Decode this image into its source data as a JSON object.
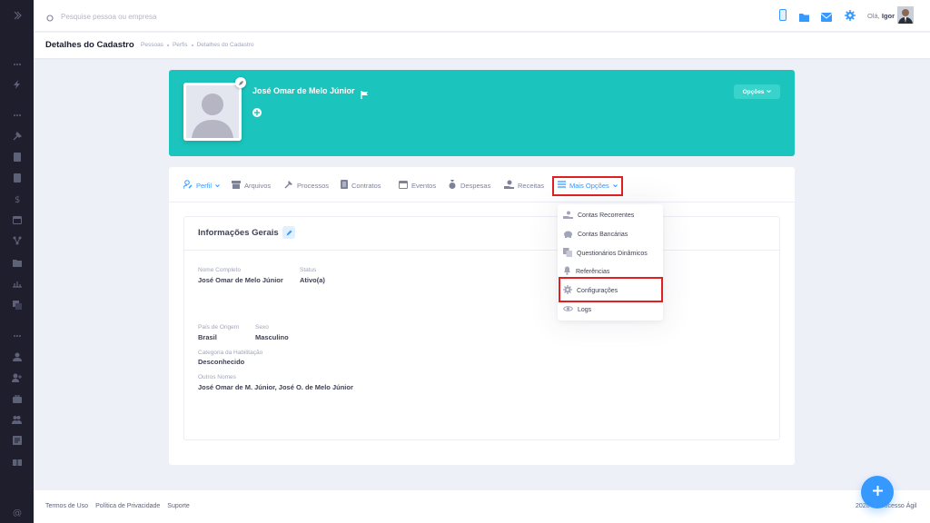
{
  "search": {
    "placeholder": "Pesquise pessoa ou empresa"
  },
  "topbar": {
    "greeting": "Olá,",
    "user": "Igor"
  },
  "subheader": {
    "title": "Detalhes do Cadastro",
    "breadcrumb": [
      "Pessoas",
      "Perfis",
      "Detalhes do Cadastro"
    ]
  },
  "profile": {
    "name": "José Omar de Melo Júnior",
    "options_label": "Opções"
  },
  "tabs": [
    {
      "label": "Perfil",
      "icon": "user-edit-icon"
    },
    {
      "label": "Arquivos",
      "icon": "archive-icon"
    },
    {
      "label": "Processos",
      "icon": "hammer-icon"
    },
    {
      "label": "Contratos",
      "icon": "document-icon"
    },
    {
      "label": "Eventos",
      "icon": "calendar-icon"
    },
    {
      "label": "Despesas",
      "icon": "money-bag-icon"
    },
    {
      "label": "Receitas",
      "icon": "hand-coin-icon"
    },
    {
      "label": "Mais Opções",
      "icon": "menu-icon"
    }
  ],
  "more_menu": [
    {
      "label": "Contas Recorrentes",
      "icon": "hand-coin-icon"
    },
    {
      "label": "Contas Bancárias",
      "icon": "piggy-bank-icon"
    },
    {
      "label": "Questionários Dinâmicos",
      "icon": "copy-icon"
    },
    {
      "label": "Referências",
      "icon": "bell-icon"
    },
    {
      "label": "Configurações",
      "icon": "gear-icon"
    },
    {
      "label": "Logs",
      "icon": "eye-icon"
    }
  ],
  "info": {
    "title": "Informações Gerais",
    "fields": {
      "nome_label": "Nome Completo",
      "nome_value": "José Omar de Melo Júnior",
      "status_label": "Status",
      "status_value": "Ativo(a)",
      "pais_label": "País de Origem",
      "pais_value": "Brasil",
      "sexo_label": "Sexo",
      "sexo_value": "Masculino",
      "cat_label": "Categoria da Habilitação",
      "cat_value": "Desconhecido",
      "outros_label": "Outros Nomes",
      "outros_value": "José Omar de M. Júnior, José O. de Melo Júnior"
    }
  },
  "footer": {
    "links": [
      "Termos de Uso",
      "Política de Privacidade",
      "Suporte"
    ],
    "copyright": "2020 © Processo Ágil"
  },
  "colors": {
    "accent": "#3699ff",
    "banner": "#1bc5bd",
    "highlight": "#e02020",
    "sidebar": "#1e1e2d"
  }
}
